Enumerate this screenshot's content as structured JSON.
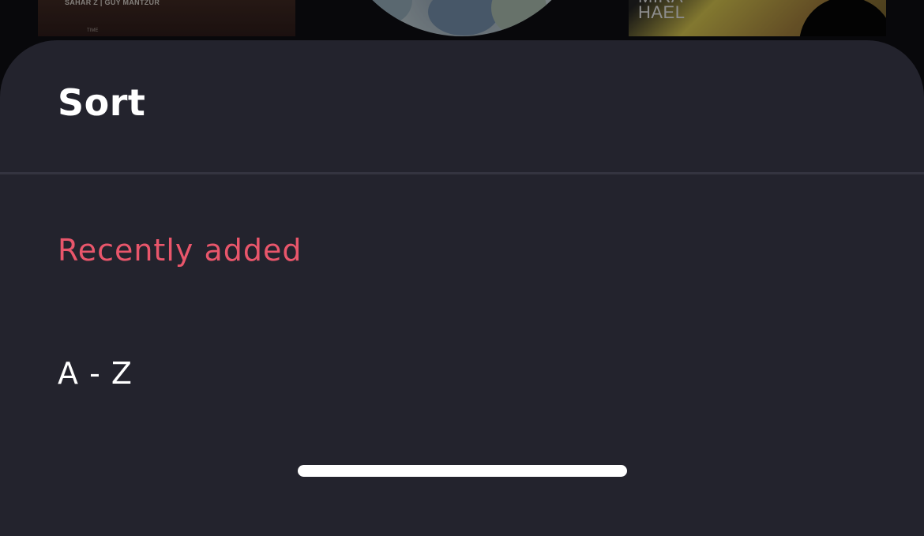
{
  "background_albums": [
    {
      "cover_text": "SAHAR Z  |  GUY MANTZUR",
      "cover_subtext": "TIME"
    },
    {
      "cover_text": ""
    },
    {
      "cover_text": "MIRA\nHAEL"
    }
  ],
  "sheet": {
    "title": "Sort",
    "options": [
      {
        "label": "Recently added",
        "selected": true
      },
      {
        "label": "A - Z",
        "selected": false
      }
    ]
  },
  "colors": {
    "sheet_background": "#23232d",
    "selected_option": "#e9566b",
    "option_text": "#ffffff",
    "divider": "#343440"
  }
}
